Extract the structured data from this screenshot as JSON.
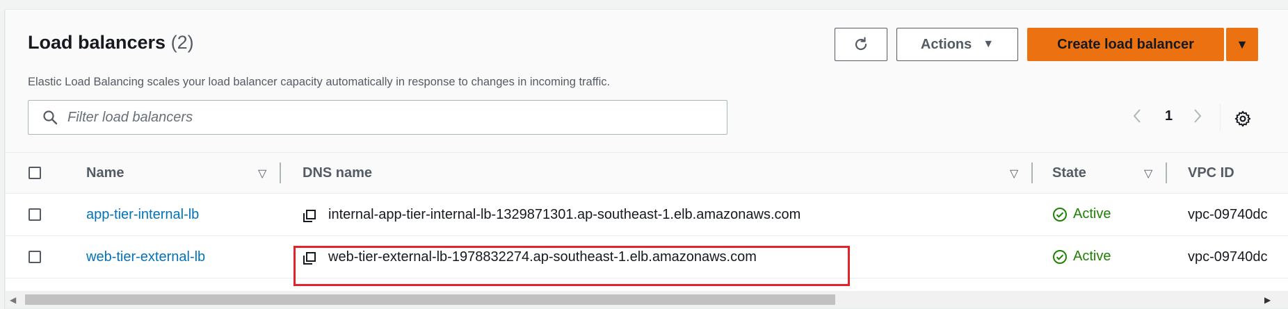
{
  "header": {
    "title": "Load balancers",
    "count": "(2)",
    "description": "Elastic Load Balancing scales your load balancer capacity automatically in response to changes in incoming traffic."
  },
  "toolbar": {
    "refresh_icon": "refresh-icon",
    "actions_label": "Actions",
    "create_label": "Create load balancer"
  },
  "search": {
    "placeholder": "Filter load balancers",
    "value": ""
  },
  "pagination": {
    "current_page": "1"
  },
  "table": {
    "columns": [
      "Name",
      "DNS name",
      "State",
      "VPC ID"
    ],
    "rows": [
      {
        "name": "app-tier-internal-lb",
        "dns": "internal-app-tier-internal-lb-1329871301.ap-southeast-1.elb.amazonaws.com",
        "state": "Active",
        "vpc": "vpc-09740dc"
      },
      {
        "name": "web-tier-external-lb",
        "dns": "web-tier-external-lb-1978832274.ap-southeast-1.elb.amazonaws.com",
        "state": "Active",
        "vpc": "vpc-09740dc"
      }
    ]
  },
  "colors": {
    "primary_button": "#ec7211",
    "link": "#0073bb",
    "status_active": "#1d8102",
    "highlight_box": "#e0242a"
  }
}
